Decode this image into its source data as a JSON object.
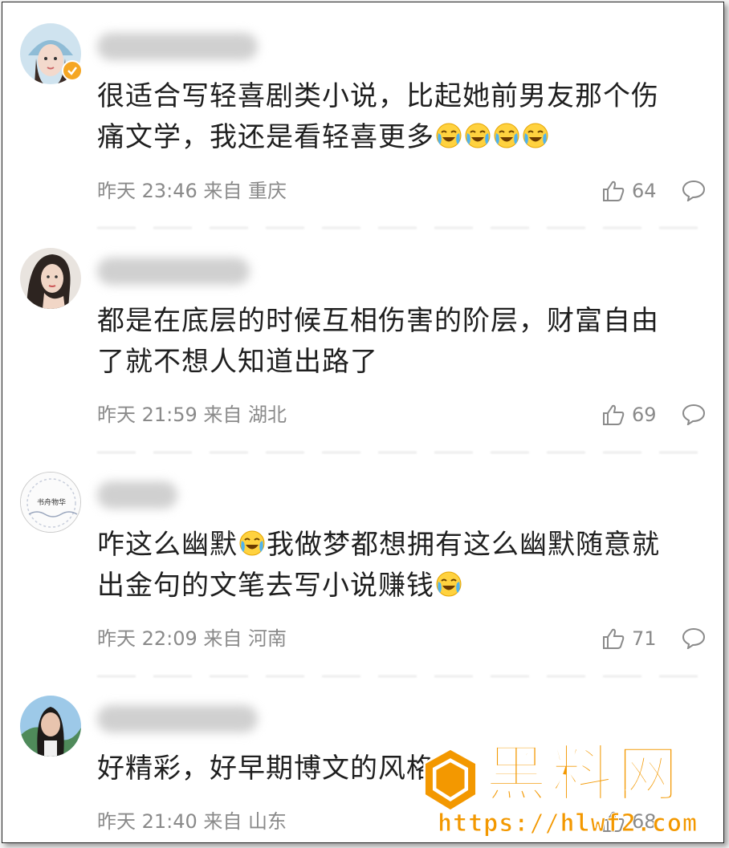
{
  "comments": [
    {
      "text_a": "很适合写轻喜剧类小说，比起她前男友那个伤",
      "text_b": "痛文学，我还是看轻喜更多",
      "emoji_count": 4,
      "time": "昨天 23:46 来自 重庆",
      "likes": "64",
      "verified": true
    },
    {
      "text_a": "都是在底层的时候互相伤害的阶层，财富自由",
      "text_b": "了就不想人知道出路了",
      "time": "昨天 21:59 来自 湖北",
      "likes": "69"
    },
    {
      "text_a": "咋这么幽默",
      "text_a2": "我做梦都想拥有这么幽默随意就",
      "text_b": "出金句的文笔去写小说赚钱",
      "avatar_text": "书舟物华",
      "time": "昨天 22:09 来自 河南",
      "likes": "71"
    },
    {
      "text_a": "好精彩，好早期博文的风格",
      "time": "昨天 21:40 来自 山东",
      "likes": "68"
    }
  ],
  "watermark": {
    "brand": "黑料网",
    "url": "https://hlwf2.com"
  },
  "icons": {
    "like": "thumbs-up-icon",
    "reply": "comment-bubble-icon",
    "emoji": "crying-laughing-emoji-icon",
    "verified": "verified-badge-icon"
  },
  "colors": {
    "text": "#1f1f1f",
    "meta": "#8a8a8a",
    "watermark_orange": "#f39800"
  }
}
